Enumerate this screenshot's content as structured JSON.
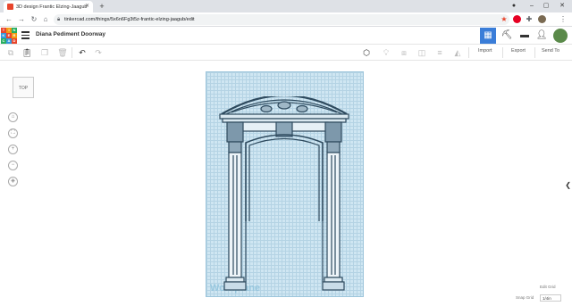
{
  "browser": {
    "tab_title": "3D design Frantic Elzing-Jaagub",
    "url": "tinkercad.com/things/5x6n6Fg3t5z-frantic-elzing-jaagub/edit",
    "new_tab": "+",
    "minimize": "–",
    "maximize": "▢",
    "close": "✕"
  },
  "app": {
    "logo_letters": [
      "T",
      "I",
      "N",
      "K",
      "E",
      "R",
      "C",
      "A",
      "D"
    ],
    "logo_colors": [
      "#e8452c",
      "#f39c12",
      "#27ae60",
      "#3498db",
      "#e8452c",
      "#f39c12",
      "#27ae60",
      "#3498db",
      "#e8452c"
    ],
    "design_title": "Diana Pediment Doorway"
  },
  "toolbar": {
    "import_label": "Import",
    "export_label": "Export",
    "send_to_label": "Send To"
  },
  "viewport": {
    "view_cube_label": "TOP",
    "workplane_label": "Workplane",
    "edit_grid_label": "Edit Grid",
    "snap_grid_label": "Snap Grid",
    "snap_grid_value": "1/4in"
  },
  "colors": {
    "accent": "#3a7dd8",
    "workplane": "#cfe6f2",
    "model_stroke": "#2e4a5e"
  }
}
